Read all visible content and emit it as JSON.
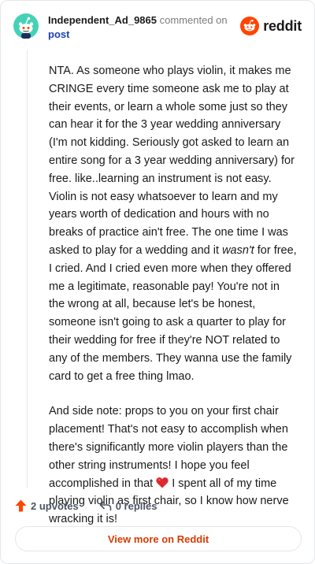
{
  "header": {
    "author": "Independent_Ad_9865",
    "meta_text": "commented on",
    "post_link": "post",
    "brand_name": "reddit"
  },
  "comment": {
    "p1_a": "NTA. As someone who plays violin, it makes me CRINGE every time someone ask me to play at their events, or learn a whole some just so they can hear it for the 3 year wedding anniversary (I'm not kidding. Seriously got asked to learn an entire song for a 3 year wedding anniversary) for free. like..learning an instrument is not easy. Violin is not easy whatsoever to learn and my years worth of dedication and hours with no breaks of practice ain't free. The one time I was asked to play for a wedding and it ",
    "p1_em": "wasn't",
    "p1_b": " for free, I cried. And I cried even more when they offered me a legitimate, reasonable pay! You're not in the wrong at all, because let's be honest, someone isn't going to ask a quarter to play for their wedding for free if they're NOT related to any of the members. They wanna use the family card to get a free thing lmao.",
    "p2_a": "And side note: props to you on your first chair placement! That's not easy to accomplish when there's significantly more violin players than the other string instruments! I hope you feel accomplished in that ",
    "p2_b": " I spent all of my time playing violin as first chair, so I know how nerve wracking it is!"
  },
  "actions": {
    "upvotes": "2 upvotes",
    "replies": "0 replies",
    "view_more": "View more on Reddit"
  },
  "colors": {
    "accent": "#d93a00",
    "upvote": "#ff4500",
    "link": "#1e40af",
    "avatar_bg": "#46d1b7"
  }
}
